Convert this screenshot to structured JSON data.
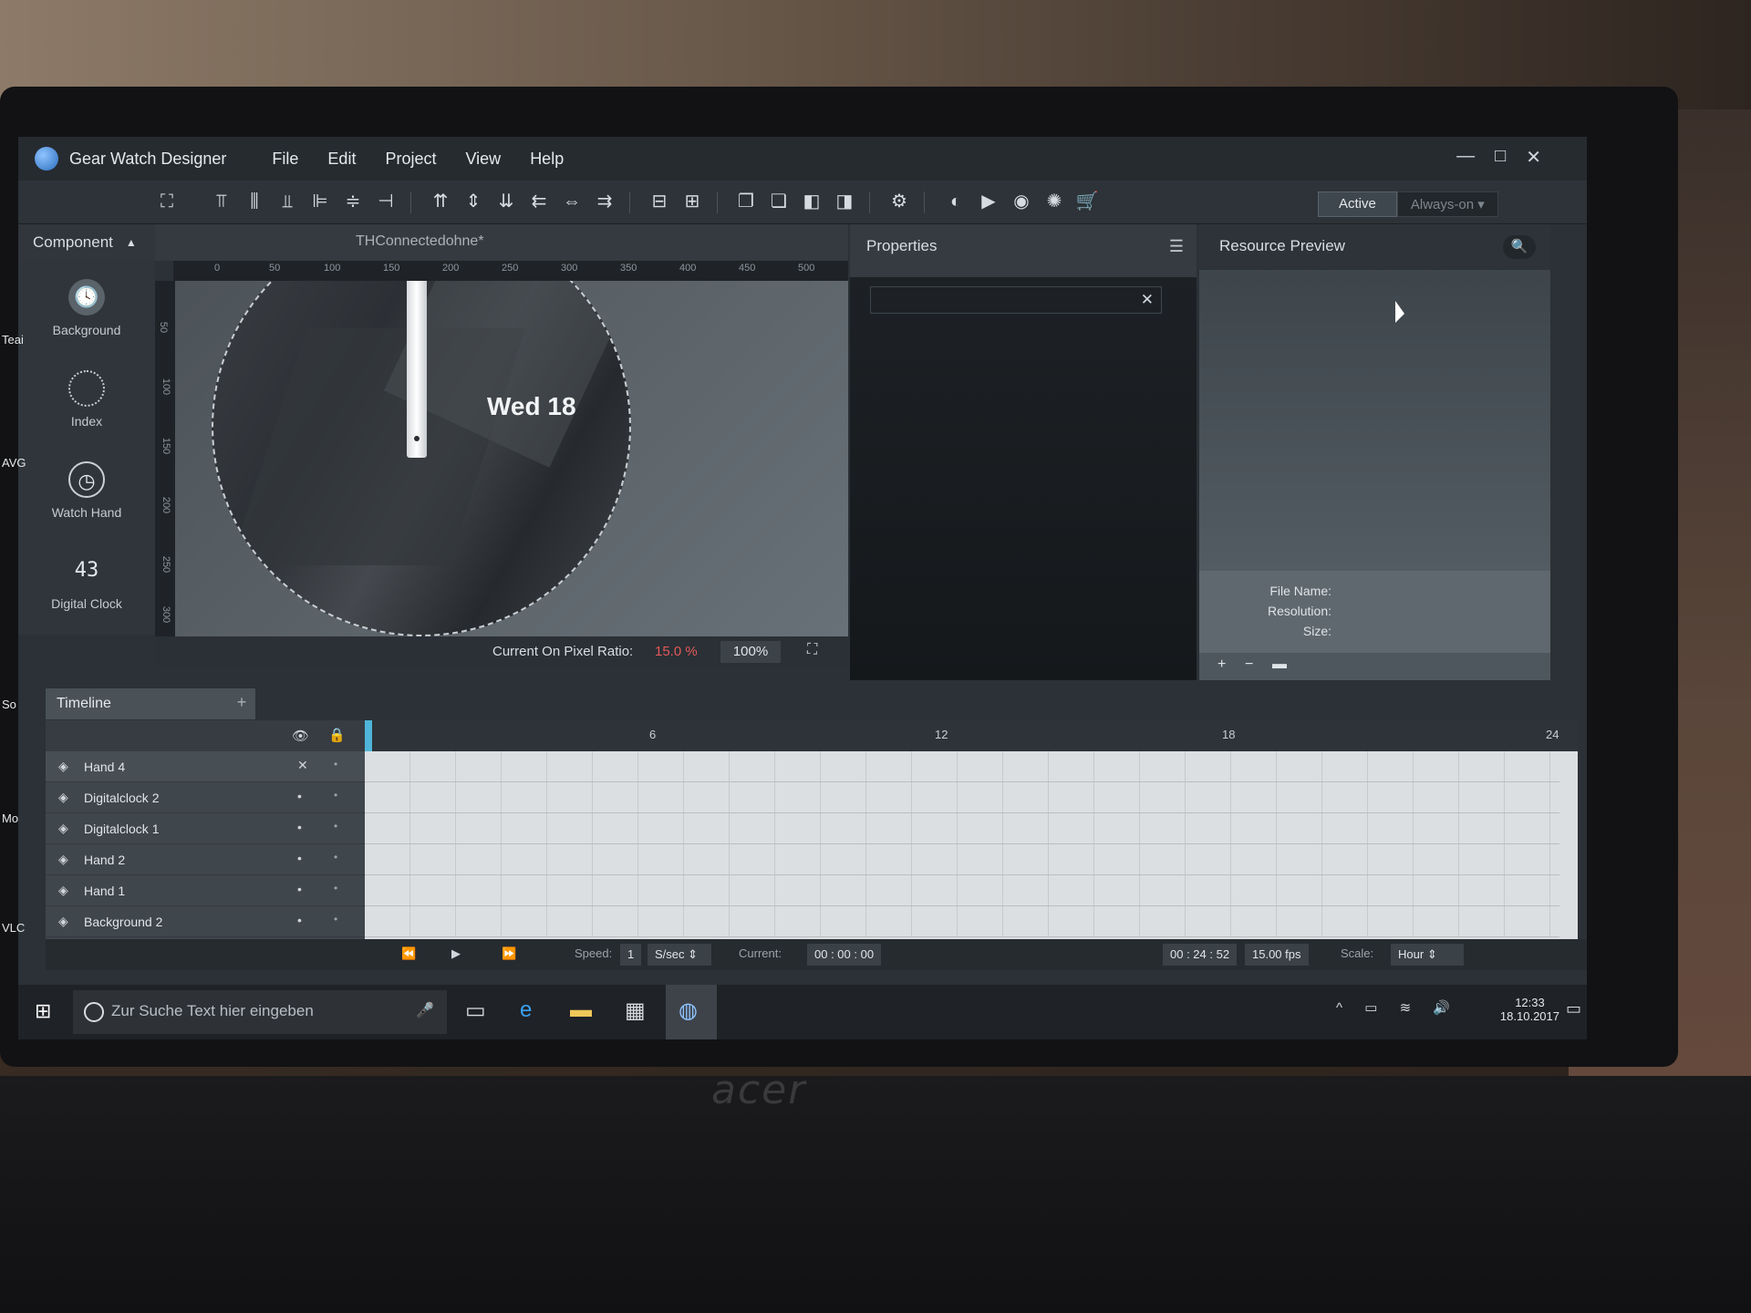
{
  "app": {
    "title": "Gear Watch Designer",
    "menu": [
      "File",
      "Edit",
      "Project",
      "View",
      "Help"
    ],
    "window_controls": [
      "—",
      "□",
      "✕"
    ]
  },
  "toolbar": {
    "mode_active": "Active",
    "mode_aod": "Always-on"
  },
  "component_panel": {
    "header": "Component",
    "items": [
      {
        "label": "Background",
        "icon": "clock-icon"
      },
      {
        "label": "Index",
        "icon": "dial-index-icon"
      },
      {
        "label": "Watch Hand",
        "icon": "watch-hand-icon"
      },
      {
        "label": "Digital Clock",
        "icon": "digital-clock-icon"
      }
    ]
  },
  "canvas": {
    "document_title": "THConnectedohne*",
    "ruler_h": [
      "0",
      "50",
      "100",
      "150",
      "200",
      "250",
      "300",
      "350",
      "400",
      "450",
      "500"
    ],
    "ruler_v": [
      "50",
      "100",
      "150",
      "200",
      "250",
      "300"
    ],
    "date_text": "Wed  18",
    "pixel_ratio_label": "Current On Pixel Ratio:",
    "pixel_ratio_value": "15.0 %",
    "zoom": "100%"
  },
  "properties": {
    "title": "Properties"
  },
  "resource_preview": {
    "title": "Resource Preview",
    "file_name_label": "File Name:",
    "resolution_label": "Resolution:",
    "size_label": "Size:",
    "actions": [
      "+",
      "−"
    ]
  },
  "timeline": {
    "title": "Timeline",
    "add": "+",
    "scale_ticks": [
      "6",
      "12",
      "18",
      "24"
    ],
    "layers": [
      "Hand 4",
      "Digitalclock 2",
      "Digitalclock 1",
      "Hand 2",
      "Hand 1",
      "Background 2"
    ],
    "speed_label": "Speed:",
    "speed_value": "1",
    "speed_unit": "S/sec",
    "current_label": "Current:",
    "current_value": "00 : 00 : 00",
    "duration": "00 : 24 : 52",
    "fps": "15.00  fps",
    "scale_label": "Scale:",
    "scale_value": "Hour"
  },
  "taskbar": {
    "search_placeholder": "Zur Suche Text hier eingeben",
    "time": "12:33",
    "date": "18.10.2017"
  },
  "desktop_icons": [
    "Teai",
    "AVG",
    "So",
    "Mo",
    "VLC"
  ]
}
